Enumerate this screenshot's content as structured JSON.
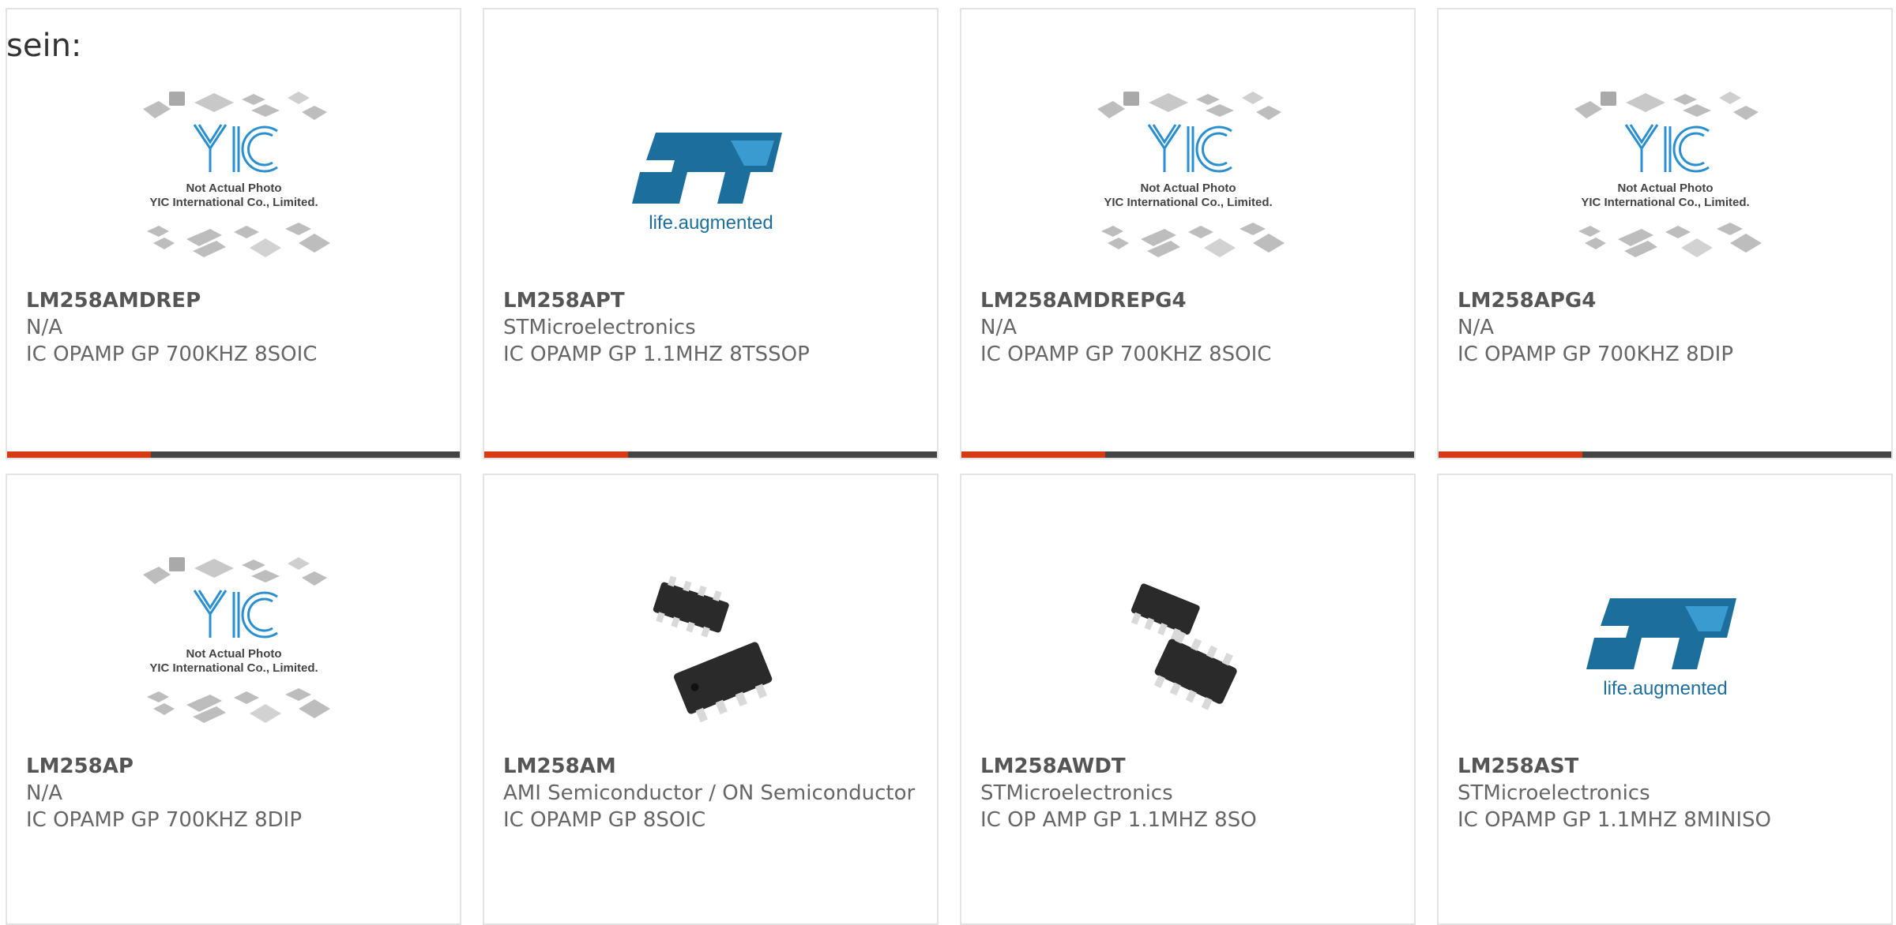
{
  "intro_text": "sein:",
  "products": [
    {
      "part": "LM258AMDREP",
      "manufacturer": "N/A",
      "description": "IC OPAMP GP 700KHZ 8SOIC",
      "image": "yic-placeholder",
      "placeholder_lines": [
        "Not Actual Photo",
        "YIC International Co., Limited."
      ]
    },
    {
      "part": "LM258APT",
      "manufacturer": "STMicroelectronics",
      "description": "IC OPAMP GP 1.1MHZ 8TSSOP",
      "image": "st-logo",
      "logo_tagline": "life.augmented"
    },
    {
      "part": "LM258AMDREPG4",
      "manufacturer": "N/A",
      "description": "IC OPAMP GP 700KHZ 8SOIC",
      "image": "yic-placeholder",
      "placeholder_lines": [
        "Not Actual Photo",
        "YIC International Co., Limited."
      ]
    },
    {
      "part": "LM258APG4",
      "manufacturer": "N/A",
      "description": "IC OPAMP GP 700KHZ 8DIP",
      "image": "yic-placeholder",
      "placeholder_lines": [
        "Not Actual Photo",
        "YIC International Co., Limited."
      ]
    },
    {
      "part": "LM258AP",
      "manufacturer": "N/A",
      "description": "IC OPAMP GP 700KHZ 8DIP",
      "image": "yic-placeholder",
      "placeholder_lines": [
        "Not Actual Photo",
        "YIC International Co., Limited."
      ]
    },
    {
      "part": "LM258AM",
      "manufacturer": "AMI Semiconductor / ON Semiconductor",
      "description": "IC OPAMP GP 8SOIC",
      "image": "soic-chip-photo"
    },
    {
      "part": "LM258AWDT",
      "manufacturer": "STMicroelectronics",
      "description": "IC OP AMP GP 1.1MHZ 8SO",
      "image": "soic-chip-photo"
    },
    {
      "part": "LM258AST",
      "manufacturer": "STMicroelectronics",
      "description": "IC OPAMP GP 1.1MHZ 8MINISO",
      "image": "st-logo",
      "logo_tagline": "life.augmented"
    }
  ],
  "colors": {
    "accent": "#d63b16",
    "bar": "#444444",
    "st_blue": "#1c6e9c",
    "yic_blue": "#2a8fd0"
  }
}
